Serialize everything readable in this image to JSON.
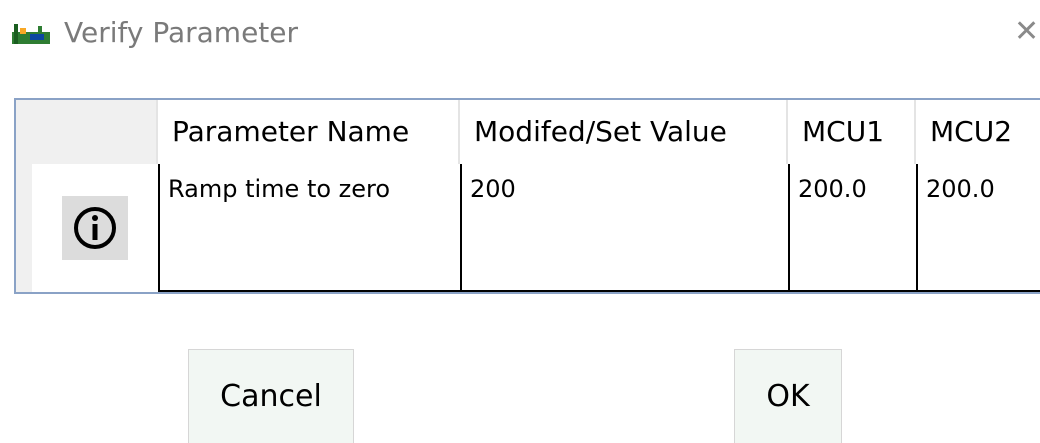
{
  "window": {
    "title": "Verify Parameter",
    "close_glyph": "✕",
    "app_icon": "app-icon"
  },
  "grid": {
    "columns": [
      "Parameter Name",
      "Modifed/Set Value",
      "MCU1",
      "MCU2"
    ],
    "rows": [
      {
        "status_icon": "info-icon",
        "parameter_name": "Ramp time to zero",
        "modified_value": "200",
        "mcu1": "200.0",
        "mcu2": "200.0"
      }
    ]
  },
  "buttons": {
    "cancel_label": "Cancel",
    "ok_label": "OK"
  }
}
